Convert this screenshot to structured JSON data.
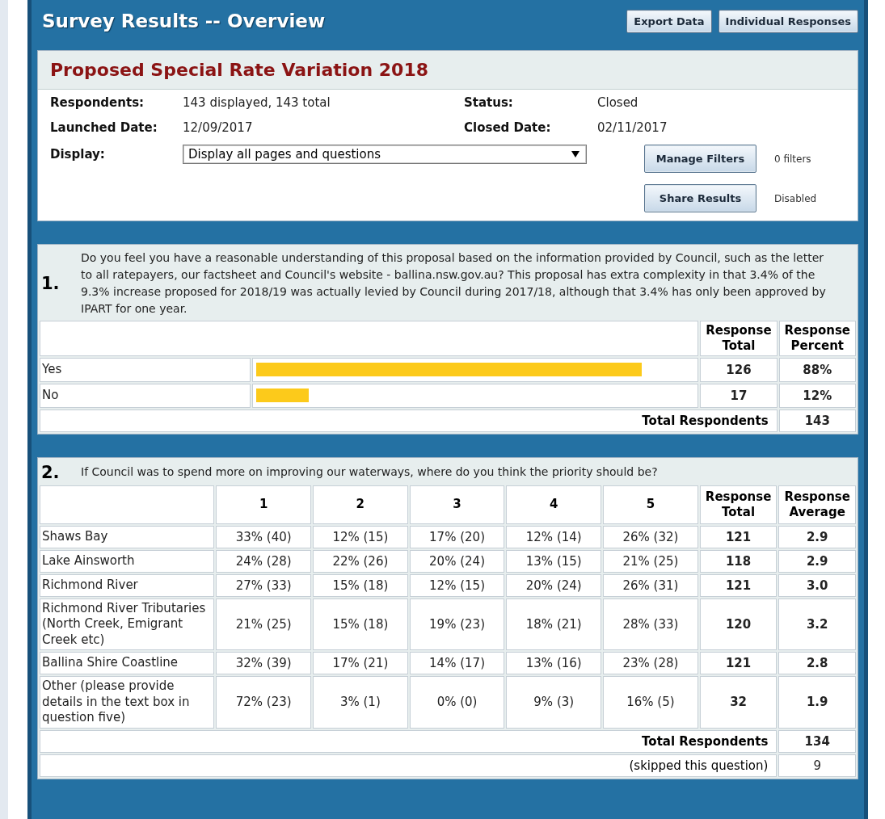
{
  "header": {
    "title": "Survey Results -- Overview",
    "buttons": [
      "Export Data",
      "Individual Responses"
    ]
  },
  "survey": {
    "title": "Proposed Special Rate Variation 2018",
    "fields": [
      {
        "label": "Respondents:",
        "value": "143 displayed, 143 total"
      },
      {
        "label": "Status:",
        "value": "Closed"
      },
      {
        "label": "Launched Date:",
        "value": "12/09/2017"
      },
      {
        "label": "Closed Date:",
        "value": "02/11/2017"
      }
    ],
    "display": {
      "label": "Display:",
      "value": "Display all pages and questions"
    },
    "actions": [
      {
        "button": "Manage Filters",
        "note": "0 filters"
      },
      {
        "button": "Share Results",
        "note": "Disabled"
      }
    ]
  },
  "questions": [
    {
      "number": "1.",
      "kind": "choice",
      "text": "Do you feel you have a reasonable understanding of this proposal based on the information provided by Council, such as the letter to all ratepayers, our factsheet and Council's website - ballina.nsw.gov.au? This proposal has extra complexity in that 3.4% of the 9.3% increase proposed for 2018/19 was actually levied by Council during 2017/18, although that 3.4% has only been approved by IPART for one year.",
      "columns": [
        "Response Total",
        "Response Percent"
      ],
      "rows": [
        {
          "label": "Yes",
          "level": 0.88,
          "cells": [],
          "total": "126",
          "last": "88%"
        },
        {
          "label": "No",
          "level": 0.12,
          "cells": [],
          "total": "17",
          "last": "12%"
        }
      ],
      "footer": [
        {
          "kind": "total",
          "label": "Total Respondents",
          "value": "143"
        }
      ]
    },
    {
      "number": "2.",
      "kind": "rating",
      "text": "If Council was to spend more on improving our waterways, where do you think the priority should be?",
      "columns": [
        "1",
        "2",
        "3",
        "4",
        "5",
        "Response Total",
        "Response Average"
      ],
      "rows": [
        {
          "label": "Shaws Bay",
          "cells": [
            "33% (40)",
            "12% (15)",
            "17% (20)",
            "12% (14)",
            "26% (32)"
          ],
          "total": "121",
          "last": "2.9"
        },
        {
          "label": "Lake Ainsworth",
          "cells": [
            "24% (28)",
            "22% (26)",
            "20% (24)",
            "13% (15)",
            "21% (25)"
          ],
          "total": "118",
          "last": "2.9"
        },
        {
          "label": "Richmond River",
          "cells": [
            "27% (33)",
            "15% (18)",
            "12% (15)",
            "20% (24)",
            "26% (31)"
          ],
          "total": "121",
          "last": "3.0"
        },
        {
          "label": "Richmond River Tributaries (North Creek, Emigrant Creek etc)",
          "cells": [
            "21% (25)",
            "15% (18)",
            "19% (23)",
            "18% (21)",
            "28% (33)"
          ],
          "total": "120",
          "last": "3.2"
        },
        {
          "label": "Ballina Shire Coastline",
          "cells": [
            "32% (39)",
            "17% (21)",
            "14% (17)",
            "13% (16)",
            "23% (28)"
          ],
          "total": "121",
          "last": "2.8"
        },
        {
          "label": "Other (please provide details in the text box in question five)",
          "cells": [
            "72% (23)",
            "3% (1)",
            "0% (0)",
            "9% (3)",
            "16% (5)"
          ],
          "total": "32",
          "last": "1.9"
        }
      ],
      "footer": [
        {
          "kind": "total",
          "label": "Total Respondents",
          "value": "134"
        },
        {
          "kind": "skipped",
          "label": "(skipped this question)",
          "value": "9"
        }
      ]
    }
  ]
}
